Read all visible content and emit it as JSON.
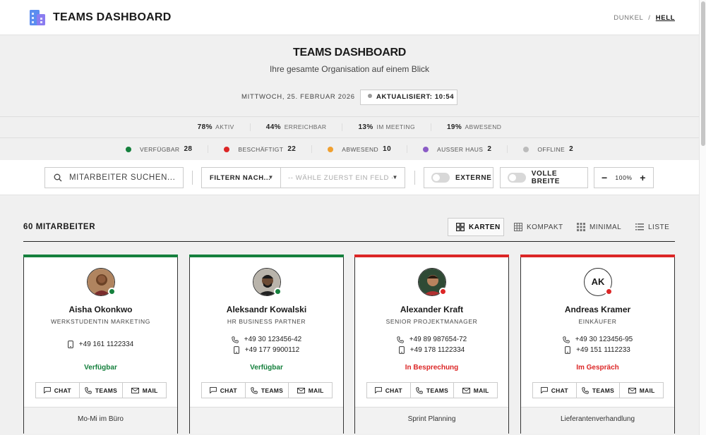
{
  "app": {
    "title": "TEAMS DASHBOARD"
  },
  "theme": {
    "dark": "DUNKEL",
    "sep": "/",
    "light": "HELL"
  },
  "hero": {
    "title": "TEAMS DASHBOARD",
    "subtitle": "Ihre gesamte Organisation auf einem Blick",
    "date": "MITTWOCH, 25. FEBRUAR 2026",
    "updated": "AKTUALISIERT: 10:54"
  },
  "summary": [
    {
      "value": "78%",
      "label": "AKTIV"
    },
    {
      "value": "44%",
      "label": "ERREICHBAR"
    },
    {
      "value": "13%",
      "label": "IM MEETING"
    },
    {
      "value": "19%",
      "label": "ABWESEND"
    }
  ],
  "status_counts": [
    {
      "label": "VERFÜGBAR",
      "count": "28",
      "color": "#15803d"
    },
    {
      "label": "BESCHÄFTIGT",
      "count": "22",
      "color": "#dc2626"
    },
    {
      "label": "ABWESEND",
      "count": "10",
      "color": "#f0a030"
    },
    {
      "label": "AUSSER HAUS",
      "count": "2",
      "color": "#8b5cc6"
    },
    {
      "label": "OFFLINE",
      "count": "2",
      "color": "#bcbcbc"
    }
  ],
  "toolbar": {
    "search_placeholder": "MITARBEITER SUCHEN...",
    "filter_label": "FILTERN NACH...",
    "field_placeholder": "-- WÄHLE ZUERST EIN FELD --",
    "externe": "EXTERNE",
    "volle_breite": "VOLLE BREITE",
    "zoom": "100%",
    "minus": "−",
    "plus": "+"
  },
  "list": {
    "count_label": "60 MITARBEITER",
    "views": [
      "KARTEN",
      "KOMPAKT",
      "MINIMAL",
      "LISTE"
    ]
  },
  "actions": {
    "chat": "CHAT",
    "teams": "TEAMS",
    "mail": "MAIL"
  },
  "employees": [
    {
      "name": "Aisha Okonkwo",
      "role": "WERKSTUDENTIN MARKETING",
      "phone": "",
      "mobile": "+49 161 1122334",
      "status": "Verfügbar",
      "status_color": "#15803d",
      "note": "Mo-Mi im Büro"
    },
    {
      "name": "Aleksandr Kowalski",
      "role": "HR BUSINESS PARTNER",
      "phone": "+49 30 123456-42",
      "mobile": "+49 177 9900112",
      "status": "Verfügbar",
      "status_color": "#15803d",
      "note": ""
    },
    {
      "name": "Alexander Kraft",
      "role": "SENIOR PROJEKTMANAGER",
      "phone": "+49 89 987654-72",
      "mobile": "+49 178 1122334",
      "status": "In Besprechung",
      "status_color": "#dc2626",
      "note": "Sprint Planning"
    },
    {
      "name": "Andreas Kramer",
      "role": "EINKÄUFER",
      "initials": "AK",
      "phone": "+49 30 123456-95",
      "mobile": "+49 151 1112233",
      "status": "Im Gespräch",
      "status_color": "#dc2626",
      "note": "Lieferantenverhandlung"
    }
  ]
}
